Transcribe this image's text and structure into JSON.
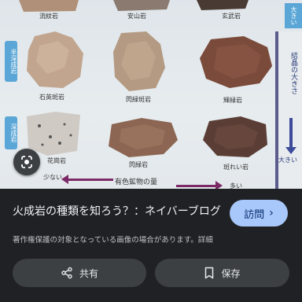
{
  "image": {
    "rock_labels": {
      "top_row": [
        "流紋岩",
        "安山岩",
        "玄武岩"
      ],
      "mid_row": [
        "石英斑岩",
        "閃緑斑岩",
        "輝緑岩"
      ],
      "bottom_row": [
        "花崗岩",
        "閃緑岩",
        "斑れい岩"
      ]
    },
    "side_tags": [
      "半深成岩",
      "深成岩"
    ],
    "top_right_tag": "大きい",
    "grain_size_label": "結晶の大きさ",
    "grain_big_label": "大きい",
    "small_label": "少ない",
    "mineral_label": "有色鉱物の量",
    "big_label": "多い"
  },
  "result": {
    "title": "火成岩の種類を知ろう？：ネイバーブログ",
    "visit_label": "訪問",
    "notice": "著作権保護の対象となっている画像の場合があります。",
    "detail_link": "詳細",
    "share_label": "共有",
    "save_label": "保存"
  },
  "icons": {
    "lens": "google-lens-icon",
    "visit_arrow": "chevron-right-icon",
    "share": "share-icon",
    "save": "bookmark-icon"
  },
  "colors": {
    "panel_bg": "#202124",
    "visit_button": "#a8c7fa",
    "action_button": "#3c4043",
    "accent_tag": "#5aa6d6"
  }
}
